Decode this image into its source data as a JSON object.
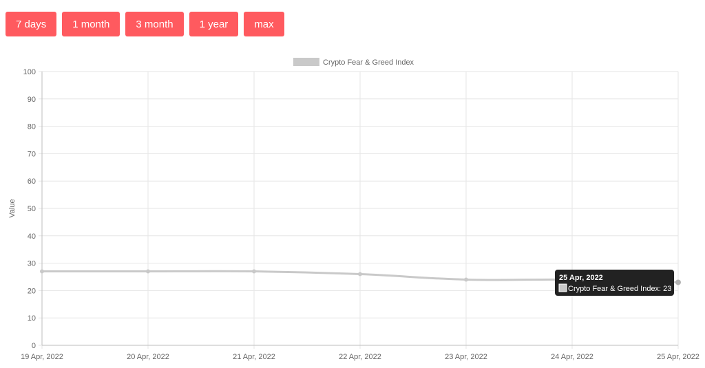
{
  "range_buttons": [
    "7 days",
    "1 month",
    "3 month",
    "1 year",
    "max"
  ],
  "chart_data": {
    "type": "line",
    "legend": "Crypto Fear & Greed Index",
    "legend_position": "top",
    "ylabel": "Value",
    "ylim": [
      0,
      100
    ],
    "y_ticks": [
      0,
      10,
      20,
      30,
      40,
      50,
      60,
      70,
      80,
      90,
      100
    ],
    "grid": true,
    "categories": [
      "19 Apr, 2022",
      "20 Apr, 2022",
      "21 Apr, 2022",
      "22 Apr, 2022",
      "23 Apr, 2022",
      "24 Apr, 2022",
      "25 Apr, 2022"
    ],
    "series": [
      {
        "name": "Crypto Fear & Greed Index",
        "values": [
          27,
          27,
          27,
          26,
          24,
          24,
          23
        ]
      }
    ],
    "tooltip": {
      "title": "25 Apr, 2022",
      "text": "Crypto Fear & Greed Index: 23"
    },
    "colors": {
      "line": "#c9c9c9",
      "button": "#ff5a5f",
      "tooltip_bg": "#222222"
    }
  }
}
